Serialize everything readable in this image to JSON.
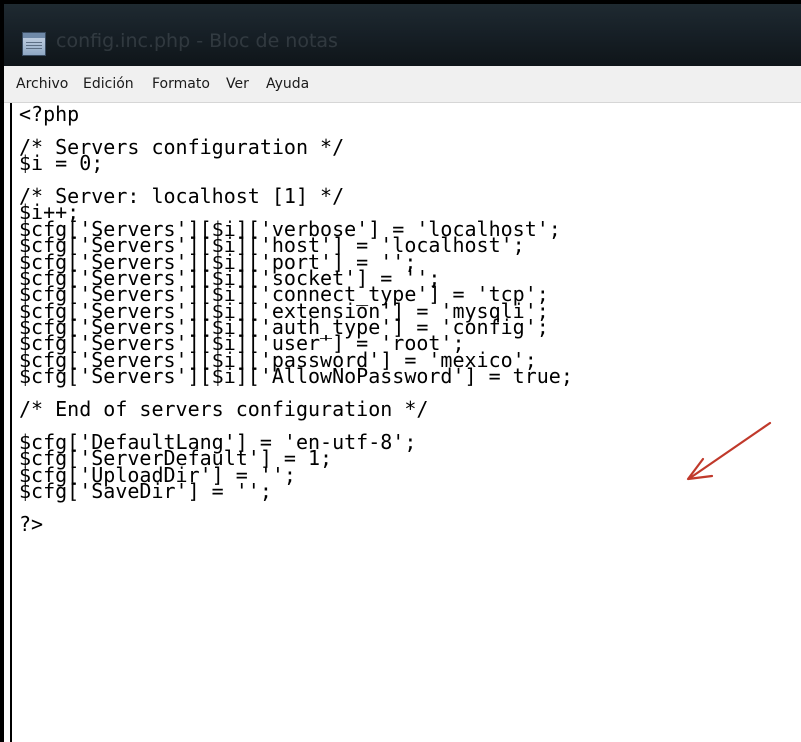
{
  "window": {
    "title": "config.inc.php - Bloc de notas"
  },
  "menu": [
    "Archivo",
    "Edición",
    "Formato",
    "Ver",
    "Ayuda"
  ],
  "code_lines": [
    "<?php",
    "",
    "/* Servers configuration */",
    "$i = 0;",
    "",
    "/* Server: localhost [1] */",
    "$i++;",
    "$cfg['Servers'][$i]['verbose'] = 'localhost';",
    "$cfg['Servers'][$i]['host'] = 'localhost';",
    "$cfg['Servers'][$i]['port'] = '';",
    "$cfg['Servers'][$i]['socket'] = '';",
    "$cfg['Servers'][$i]['connect_type'] = 'tcp';",
    "$cfg['Servers'][$i]['extension'] = 'mysqli';",
    "$cfg['Servers'][$i]['auth_type'] = 'config';",
    "$cfg['Servers'][$i]['user'] = 'root';",
    "$cfg['Servers'][$i]['password'] = 'mexico';",
    "$cfg['Servers'][$i]['AllowNoPassword'] = true;",
    "",
    "/* End of servers configuration */",
    "",
    "$cfg['DefaultLang'] = 'en-utf-8';",
    "$cfg['ServerDefault'] = 1;",
    "$cfg['UploadDir'] = '';",
    "$cfg['SaveDir'] = '';",
    "",
    "?>"
  ],
  "annotation": {
    "arrow_color": "#c0392b",
    "points_to": "password line"
  }
}
